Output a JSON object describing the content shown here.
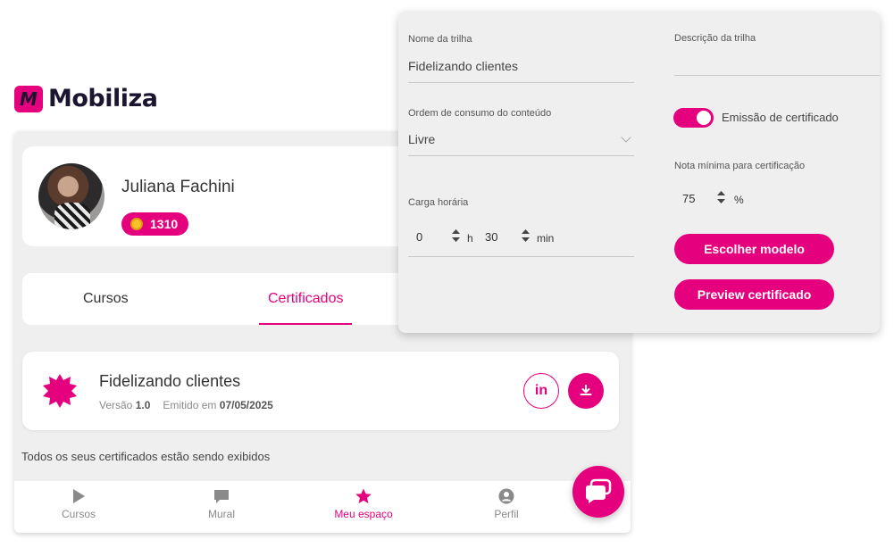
{
  "brand": {
    "name": "Mobiliza",
    "mark": "M",
    "accent": "#e5007e",
    "dark": "#1c1530"
  },
  "profile": {
    "name": "Juliana Fachini",
    "points": "1310",
    "points_icon": "coin-icon"
  },
  "tabs": [
    {
      "label": "Cursos",
      "active": false
    },
    {
      "label": "Certificados",
      "active": true
    }
  ],
  "certificate": {
    "title": "Fidelizando clientes",
    "version_label": "Versão",
    "version": "1.0",
    "issued_label": "Emitido em",
    "issued_date": "07/05/2025",
    "linkedin_label": "in"
  },
  "all_shown_text": "Todos os seus certificados estão sendo exibidos",
  "bottom_nav": [
    {
      "label": "Cursos",
      "icon": "play-icon",
      "active": false
    },
    {
      "label": "Mural",
      "icon": "chat-bubble-icon",
      "active": false
    },
    {
      "label": "Meu espaço",
      "icon": "star-icon",
      "active": true
    },
    {
      "label": "Perfil",
      "icon": "user-icon",
      "active": false
    }
  ],
  "settings": {
    "trail_name_label": "Nome da trilha",
    "trail_name_value": "Fidelizando clientes",
    "description_label": "Descrição da trilha",
    "description_value": "",
    "order_label": "Ordem de consumo do conteúdo",
    "order_value": "Livre",
    "workload_label": "Carga horária",
    "hours_value": "0",
    "hours_unit": "h",
    "minutes_value": "30",
    "minutes_unit": "min",
    "certificate_toggle_label": "Emissão de certificado",
    "certificate_toggle_on": true,
    "min_grade_label": "Nota mínima para certificação",
    "min_grade_value": "75",
    "min_grade_unit": "%",
    "choose_model_button": "Escolher modelo",
    "preview_button": "Preview certificado"
  }
}
